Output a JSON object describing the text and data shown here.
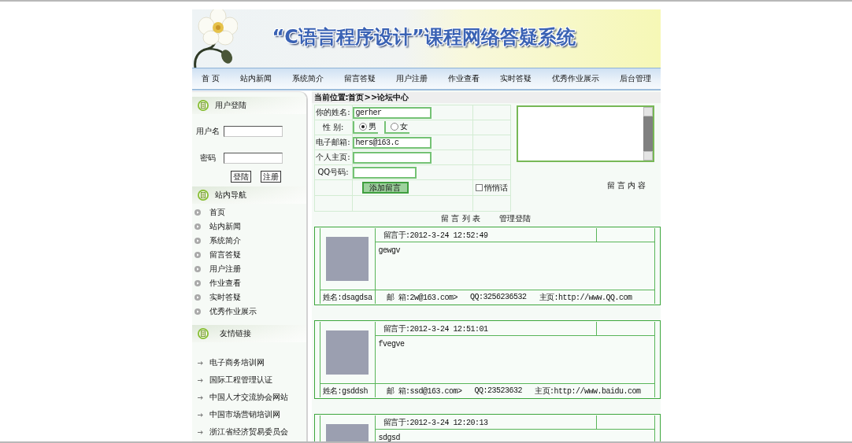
{
  "banner": {
    "title": "“C语言程序设计”课程网络答疑系统"
  },
  "nav": [
    "首 页",
    "站内新闻",
    "系统简介",
    "留言答疑",
    "用户注册",
    "作业查看",
    "实时答疑",
    "优秀作业展示",
    "后台管理"
  ],
  "sidebar": {
    "login": {
      "title": "用户登陆",
      "fields": [
        {
          "label": "用户名"
        },
        {
          "label": "密码"
        }
      ],
      "buttons": [
        "登陆",
        "注册"
      ]
    },
    "site_nav": {
      "title": "站内导航",
      "items": [
        "首页",
        "站内新闻",
        "系统简介",
        "留言答疑",
        "用户注册",
        "作业查看",
        "实时答疑",
        "优秀作业展示"
      ]
    },
    "friend_links": {
      "title": "友情链接",
      "items": [
        "电子商务培训网",
        "国际工程管理认证",
        "中国人才交流协会网站",
        "中国市场营销培训网",
        "浙江省经济贸易委员会"
      ]
    }
  },
  "breadcrumb": "当前位置:首页>>论坛中心",
  "form": {
    "fields": [
      {
        "kind": "text",
        "label": "你的姓名:",
        "value": "gerher"
      },
      {
        "kind": "radio",
        "label": "性 别:",
        "options": [
          {
            "label": "男",
            "selected": true
          },
          {
            "label": "女",
            "selected": false
          }
        ]
      },
      {
        "kind": "text",
        "label": "电子邮箱:",
        "value": "hers@163.c"
      },
      {
        "kind": "text",
        "label": "个人主页:"
      },
      {
        "kind": "text",
        "label": "QQ号码:"
      }
    ],
    "submit": "添加留言",
    "private": {
      "label": "悄悄话",
      "checked": false
    },
    "content_label": "留 言 内 容"
  },
  "list_links": [
    "留 言 列 表",
    "管理登陆"
  ],
  "messages": [
    {
      "posted": "留言于:2012-3-24 12:52:49",
      "body": "gewgv",
      "name": "姓名:dsagdsa",
      "email": "邮 箱:2w@163.com>",
      "qq": "QQ:3256236532",
      "homepage": "主页:http://www.QQ.com"
    },
    {
      "posted": "留言于:2012-3-24 12:51:01",
      "body": "fvegve",
      "name": "姓名:gsddsh",
      "email": "邮 箱:ssd@163.com>",
      "qq": "QQ:23523632",
      "homepage": "主页:http://www.baidu.com"
    },
    {
      "posted": "留言于:2012-3-24 12:20:13",
      "body": "sdgsd"
    }
  ]
}
